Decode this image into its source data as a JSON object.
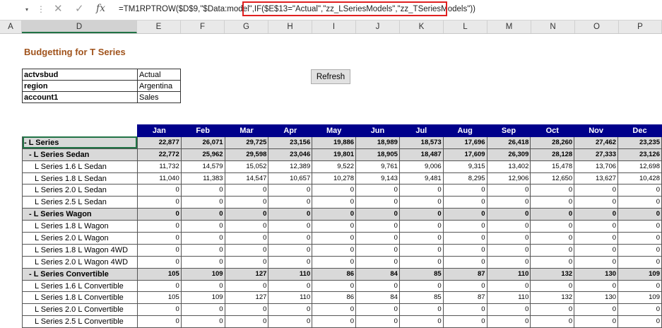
{
  "formula_bar": {
    "namebox_arrow": "▾",
    "separator": "⋮",
    "cancel_icon": "✕",
    "enter_icon": "✓",
    "fx_label": "fx",
    "formula": "=TM1RPTROW($D$9,\"$Data:model\",IF($E$13=\"Actual\",\"zz_LSeriesModels\",\"zz_TSeriesModels\"))"
  },
  "column_headers": [
    "A",
    "D",
    "E",
    "F",
    "G",
    "H",
    "I",
    "J",
    "K",
    "L",
    "M",
    "N",
    "O",
    "P"
  ],
  "sheet": {
    "title": "Budgetting for T Series",
    "params": [
      {
        "key": "actvsbud",
        "value": "Actual"
      },
      {
        "key": "region",
        "value": "Argentina"
      },
      {
        "key": "account1",
        "value": "Sales"
      }
    ],
    "refresh_label": "Refresh",
    "months": [
      "Jan",
      "Feb",
      "Mar",
      "Apr",
      "May",
      "Jun",
      "Jul",
      "Aug",
      "Sep",
      "Oct",
      "Nov",
      "Dec"
    ],
    "rows": [
      {
        "label": "- L Series",
        "level": 0,
        "values": [
          "22,877",
          "26,071",
          "29,725",
          "23,156",
          "19,886",
          "18,989",
          "18,573",
          "17,696",
          "26,418",
          "28,260",
          "27,462",
          "23,235"
        ]
      },
      {
        "label": "- L Series Sedan",
        "level": 1,
        "values": [
          "22,772",
          "25,962",
          "29,598",
          "23,046",
          "19,801",
          "18,905",
          "18,487",
          "17,609",
          "26,309",
          "28,128",
          "27,333",
          "23,126"
        ]
      },
      {
        "label": "L Series 1.6 L Sedan",
        "level": 2,
        "values": [
          "11,732",
          "14,579",
          "15,052",
          "12,389",
          "9,522",
          "9,761",
          "9,006",
          "9,315",
          "13,402",
          "15,478",
          "13,706",
          "12,698"
        ]
      },
      {
        "label": "L Series 1.8 L Sedan",
        "level": 2,
        "values": [
          "11,040",
          "11,383",
          "14,547",
          "10,657",
          "10,278",
          "9,143",
          "9,481",
          "8,295",
          "12,906",
          "12,650",
          "13,627",
          "10,428"
        ]
      },
      {
        "label": "L Series 2.0 L Sedan",
        "level": 2,
        "values": [
          "0",
          "0",
          "0",
          "0",
          "0",
          "0",
          "0",
          "0",
          "0",
          "0",
          "0",
          "0"
        ]
      },
      {
        "label": "L Series 2.5 L Sedan",
        "level": 2,
        "values": [
          "0",
          "0",
          "0",
          "0",
          "0",
          "0",
          "0",
          "0",
          "0",
          "0",
          "0",
          "0"
        ]
      },
      {
        "label": "- L Series Wagon",
        "level": 1,
        "values": [
          "0",
          "0",
          "0",
          "0",
          "0",
          "0",
          "0",
          "0",
          "0",
          "0",
          "0",
          "0"
        ]
      },
      {
        "label": "L Series 1.8 L Wagon",
        "level": 2,
        "values": [
          "0",
          "0",
          "0",
          "0",
          "0",
          "0",
          "0",
          "0",
          "0",
          "0",
          "0",
          "0"
        ]
      },
      {
        "label": "L Series 2.0 L Wagon",
        "level": 2,
        "values": [
          "0",
          "0",
          "0",
          "0",
          "0",
          "0",
          "0",
          "0",
          "0",
          "0",
          "0",
          "0"
        ]
      },
      {
        "label": "L Series 1.8 L Wagon 4WD",
        "level": 2,
        "values": [
          "0",
          "0",
          "0",
          "0",
          "0",
          "0",
          "0",
          "0",
          "0",
          "0",
          "0",
          "0"
        ]
      },
      {
        "label": "L Series 2.0 L Wagon 4WD",
        "level": 2,
        "values": [
          "0",
          "0",
          "0",
          "0",
          "0",
          "0",
          "0",
          "0",
          "0",
          "0",
          "0",
          "0"
        ]
      },
      {
        "label": "- L Series Convertible",
        "level": 1,
        "values": [
          "105",
          "109",
          "127",
          "110",
          "86",
          "84",
          "85",
          "87",
          "110",
          "132",
          "130",
          "109"
        ]
      },
      {
        "label": "L Series 1.6 L Convertible",
        "level": 2,
        "values": [
          "0",
          "0",
          "0",
          "0",
          "0",
          "0",
          "0",
          "0",
          "0",
          "0",
          "0",
          "0"
        ]
      },
      {
        "label": "L Series 1.8 L Convertible",
        "level": 2,
        "values": [
          "105",
          "109",
          "127",
          "110",
          "86",
          "84",
          "85",
          "87",
          "110",
          "132",
          "130",
          "109"
        ]
      },
      {
        "label": "L Series 2.0 L Convertible",
        "level": 2,
        "values": [
          "0",
          "0",
          "0",
          "0",
          "0",
          "0",
          "0",
          "0",
          "0",
          "0",
          "0",
          "0"
        ]
      },
      {
        "label": "L Series 2.5 L Convertible",
        "level": 2,
        "values": [
          "0",
          "0",
          "0",
          "0",
          "0",
          "0",
          "0",
          "0",
          "0",
          "0",
          "0",
          "0"
        ]
      }
    ]
  }
}
